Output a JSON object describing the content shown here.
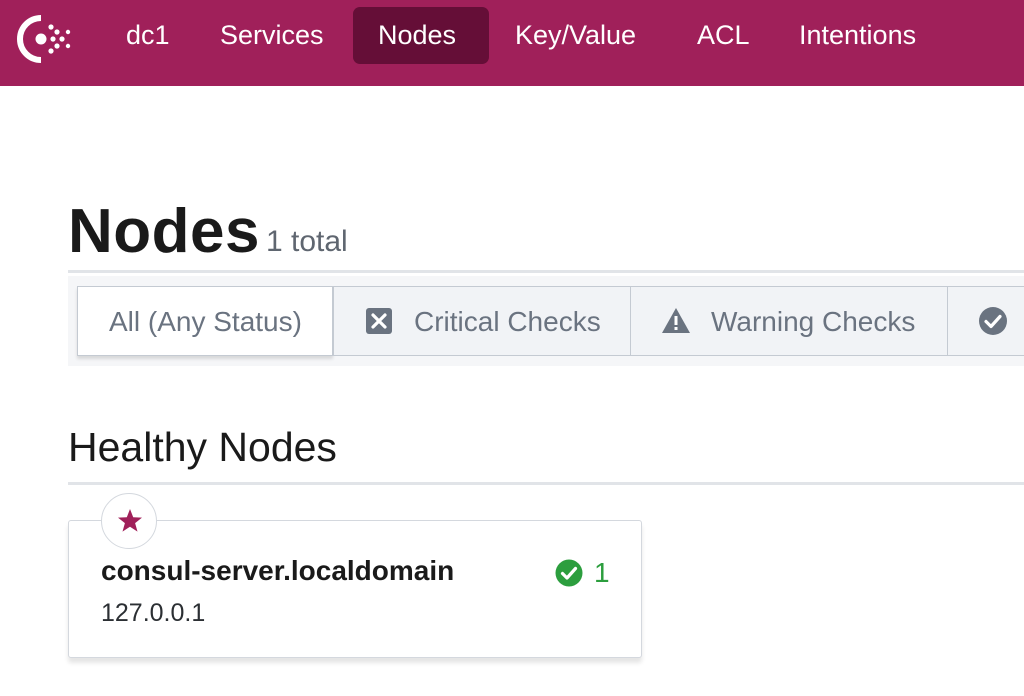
{
  "brand": {
    "logo_icon": "consul-logo-icon",
    "color": "#a0205a",
    "active_color": "#650e37"
  },
  "nav": {
    "items": [
      {
        "label": "dc1",
        "active": false
      },
      {
        "label": "Services",
        "active": false
      },
      {
        "label": "Nodes",
        "active": true
      },
      {
        "label": "Key/Value",
        "active": false
      },
      {
        "label": "ACL",
        "active": false
      },
      {
        "label": "Intentions",
        "active": false
      }
    ]
  },
  "page": {
    "title": "Nodes",
    "count": "1 total"
  },
  "filters": [
    {
      "label": "All (Any Status)",
      "icon": null,
      "active": true
    },
    {
      "label": "Critical Checks",
      "icon": "critical-x-icon",
      "active": false
    },
    {
      "label": "Warning Checks",
      "icon": "warning-triangle-icon",
      "active": false
    },
    {
      "label": "",
      "icon": "passing-check-icon",
      "active": false
    }
  ],
  "section": {
    "title": "Healthy Nodes"
  },
  "nodes": [
    {
      "name": "consul-server.localdomain",
      "address": "127.0.0.1",
      "leader_icon": "star-icon",
      "health_icon": "check-circle-icon",
      "passing_count": "1",
      "passing_color": "#2c9e3e"
    }
  ]
}
